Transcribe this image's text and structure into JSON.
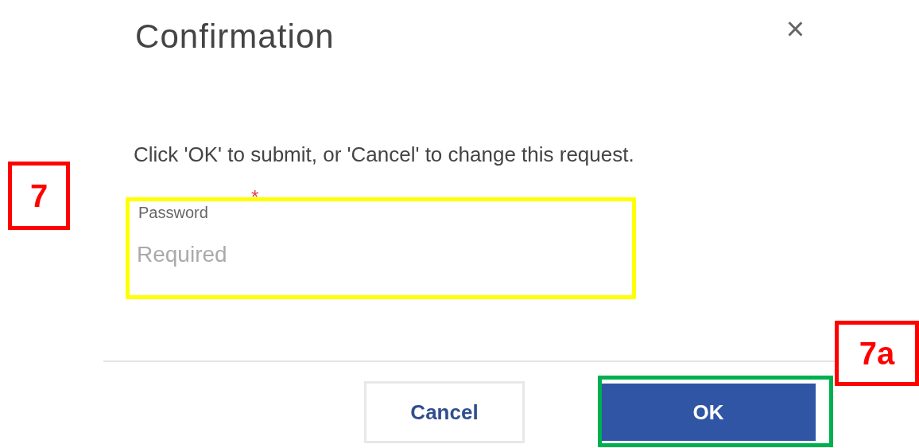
{
  "dialog": {
    "title": "Confirmation",
    "close": "×",
    "message": "Click 'OK' to submit, or 'Cancel' to change this request.",
    "field": {
      "label": "Password",
      "required_mark": "*",
      "placeholder": "Required"
    },
    "buttons": [
      {
        "label": "Cancel",
        "kind": "secondary"
      },
      {
        "label": "OK",
        "kind": "primary"
      }
    ]
  },
  "annotations": [
    {
      "label": "7"
    },
    {
      "label": "7a"
    }
  ]
}
